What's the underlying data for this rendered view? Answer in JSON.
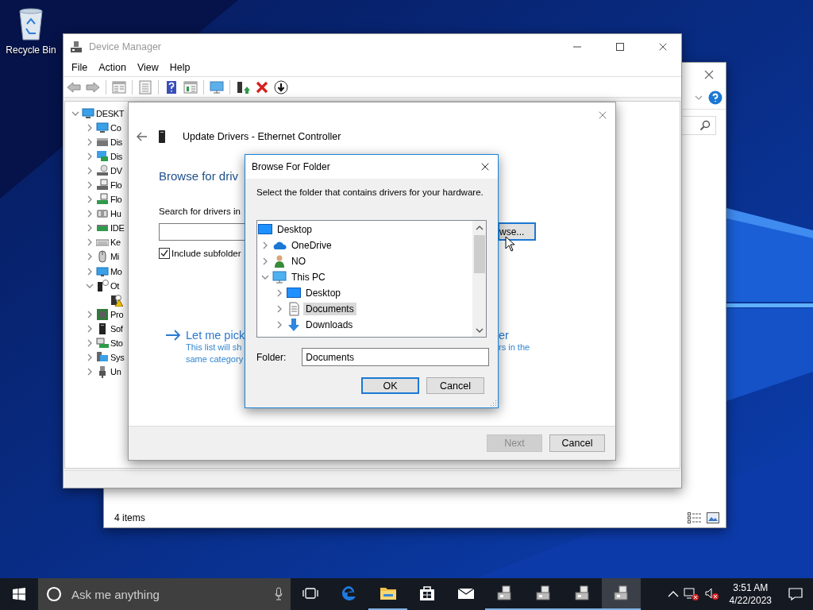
{
  "desktop": {
    "icon": {
      "label": "Recycle Bin"
    }
  },
  "background_window": {
    "status": "4 items"
  },
  "device_manager": {
    "title": "Device Manager",
    "menu": [
      "File",
      "Action",
      "View",
      "Help"
    ],
    "tree": {
      "label": "DESKT",
      "kind": "computer",
      "expanded": true,
      "children": [
        {
          "label": "Co",
          "kind": "computer",
          "expanded": false
        },
        {
          "label": "Dis",
          "kind": "disk",
          "expanded": false
        },
        {
          "label": "Dis",
          "kind": "display",
          "expanded": false
        },
        {
          "label": "DV",
          "kind": "dvd",
          "expanded": false
        },
        {
          "label": "Flo",
          "kind": "floppy",
          "expanded": false
        },
        {
          "label": "Flo",
          "kind": "floppy-controller",
          "expanded": false
        },
        {
          "label": "Hu",
          "kind": "hid",
          "expanded": false
        },
        {
          "label": "IDE",
          "kind": "ide",
          "expanded": false
        },
        {
          "label": "Ke",
          "kind": "keyboard",
          "expanded": false
        },
        {
          "label": "Mi",
          "kind": "mouse",
          "expanded": false
        },
        {
          "label": "Mo",
          "kind": "monitor",
          "expanded": false
        },
        {
          "label": "Ot",
          "kind": "unknown",
          "expanded": true,
          "children": [
            {
              "kind": "warning"
            }
          ]
        },
        {
          "label": "Pro",
          "kind": "processor",
          "expanded": false
        },
        {
          "label": "Sof",
          "kind": "tower",
          "expanded": false
        },
        {
          "label": "Sto",
          "kind": "storage",
          "expanded": false
        },
        {
          "label": "Sys",
          "kind": "system",
          "expanded": false
        },
        {
          "label": "Un",
          "kind": "usb",
          "expanded": false
        }
      ]
    }
  },
  "update_drivers": {
    "title": "Update Drivers - Ethernet Controller",
    "heading": "Browse for driv",
    "search_label": "Search for drivers in",
    "browse_button": "wse...",
    "include_subfolders": {
      "label": "Include subfolder",
      "checked": true
    },
    "pick_link": {
      "left": "Let me pick",
      "right": "er"
    },
    "description": [
      {
        "left": "This list will sh",
        "right": "rs in the"
      },
      {
        "left": "same category"
      }
    ],
    "buttons": [
      {
        "label": "Next",
        "disabled": true
      },
      {
        "label": "Cancel",
        "disabled": false
      }
    ]
  },
  "browse_for_folder": {
    "title": "Browse For Folder",
    "instruction": "Select the folder that contains drivers for your hardware.",
    "tree": {
      "label": "Desktop",
      "kind": "desktop",
      "selected": false,
      "children": [
        {
          "label": "OneDrive",
          "kind": "cloud",
          "expanded": false,
          "selected": false
        },
        {
          "label": "NO",
          "kind": "user",
          "expanded": false,
          "selected": false
        },
        {
          "label": "This PC",
          "kind": "pc",
          "expanded": true,
          "selected": false,
          "children": [
            {
              "label": "Desktop",
              "kind": "desktop",
              "expanded": false,
              "selected": false
            },
            {
              "label": "Documents",
              "kind": "documents",
              "expanded": false,
              "selected": true
            },
            {
              "label": "Downloads",
              "kind": "downloads",
              "expanded": false,
              "selected": false
            }
          ]
        }
      ]
    },
    "folder_label": "Folder:",
    "folder_value": "Documents",
    "buttons": [
      {
        "label": "OK",
        "default": true
      },
      {
        "label": "Cancel",
        "default": false
      }
    ]
  },
  "taskbar": {
    "search_placeholder": "Ask me anything",
    "apps": [
      {
        "kind": "edge",
        "running": false,
        "selected": false
      },
      {
        "kind": "folder",
        "running": true,
        "selected": false
      },
      {
        "kind": "store",
        "running": false,
        "selected": false
      },
      {
        "kind": "mail",
        "running": false,
        "selected": false
      },
      {
        "kind": "device-manager",
        "running": true,
        "selected": false
      },
      {
        "kind": "device-manager",
        "running": true,
        "selected": false
      },
      {
        "kind": "device-manager",
        "running": true,
        "selected": false
      },
      {
        "kind": "device-manager",
        "running": true,
        "selected": true
      }
    ],
    "time": "3:51 AM",
    "date": "4/22/2023"
  }
}
